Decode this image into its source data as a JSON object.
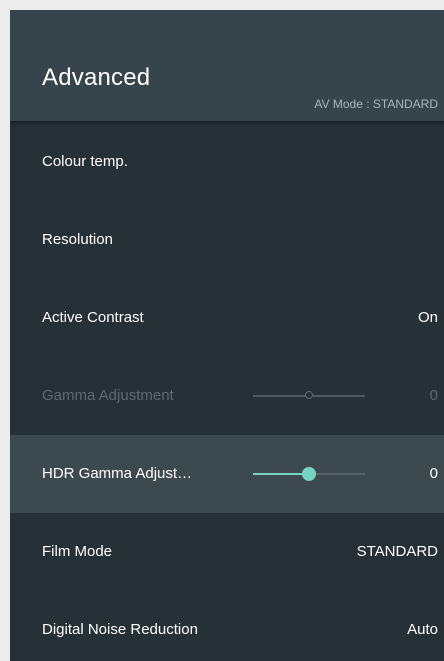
{
  "header": {
    "title": "Advanced",
    "av_mode": "AV Mode : STANDARD"
  },
  "accent_color": "#76d3c2",
  "rows": [
    {
      "label": "Colour temp.",
      "value": ""
    },
    {
      "label": "Resolution",
      "value": ""
    },
    {
      "label": "Active Contrast",
      "value": "On"
    },
    {
      "label": "Gamma Adjustment",
      "value": "0",
      "disabled": true,
      "slider_position": 0.5
    },
    {
      "label": "HDR Gamma Adjust…",
      "value": "0",
      "selected": true,
      "slider_position": 0.5
    },
    {
      "label": "Film Mode",
      "value": "STANDARD"
    },
    {
      "label": "Digital Noise Reduction",
      "value": "Auto"
    }
  ]
}
